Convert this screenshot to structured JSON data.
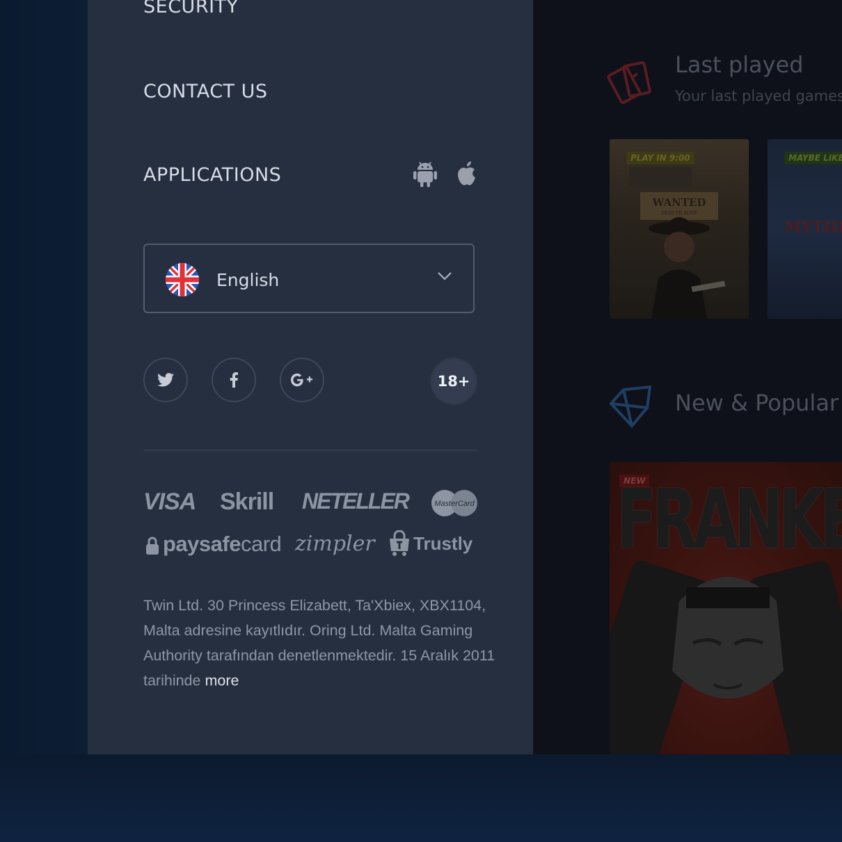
{
  "menu": {
    "security": "SECURITY",
    "contact_us": "CONTACT US",
    "applications": "APPLICATIONS",
    "app_icons": [
      "android-icon",
      "apple-icon"
    ]
  },
  "language": {
    "selected": "English",
    "flag": "uk-flag-icon"
  },
  "social": {
    "links": [
      "twitter-icon",
      "facebook-icon",
      "google-plus-icon"
    ],
    "age_badge": "18+"
  },
  "payments": {
    "visa": "VISA",
    "skrill": "Skrill",
    "neteller": "NETELLER",
    "mastercard": "MasterCard",
    "paysafe_bold": "paysafe",
    "paysafe_light": "card",
    "zimpler": "zimpler",
    "trustly": "Trustly"
  },
  "legal": {
    "text": "Twin Ltd. 30 Princess Elizabett, Ta'Xbiex, XBX1104, Malta adresine kayıtlıdır. Oring Ltd. Malta Gaming Authority tarafından denetlenmektedir. 15 Aralık 2011 tarihinde",
    "more": "more"
  },
  "content": {
    "last_played": {
      "title": "Last played",
      "subtitle": "Your last played games",
      "games": [
        {
          "badge": "PLAY IN 9:00",
          "name": "WANTED",
          "sub": "DEAD OR ALIVE"
        },
        {
          "badge": "MAYBE LIKE",
          "name": "MYTHIC"
        }
      ]
    },
    "new_popular": {
      "title": "New & Popular",
      "games": [
        {
          "badge": "NEW",
          "name": "FRANKENSTEIN"
        }
      ]
    }
  },
  "colors": {
    "panel": "#262f40",
    "menu_text": "#d7dce6",
    "muted_text": "#8f97a5",
    "accent_red": "#b3262b"
  }
}
